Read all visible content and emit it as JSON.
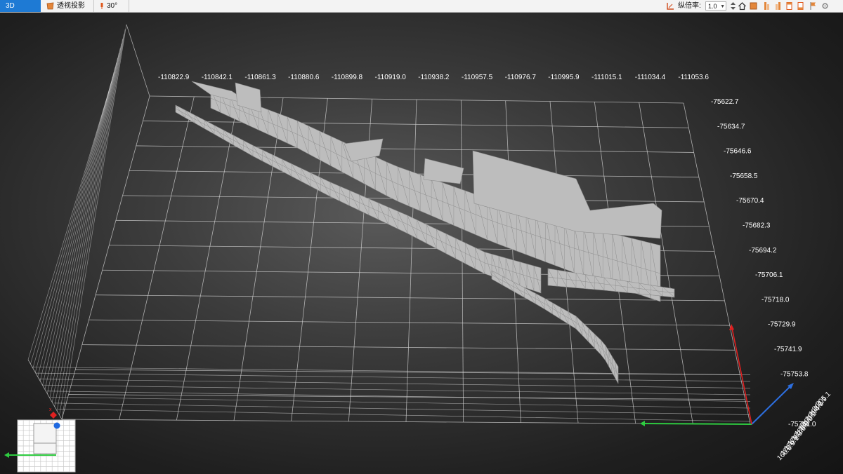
{
  "toolbar": {
    "view_3d": "3D",
    "perspective": "透视投影",
    "angle": "30°",
    "ratio_label": "纵倍率:",
    "ratio_value": "1.0",
    "tools": [
      "home-icon",
      "box-icon",
      "wall-left-icon",
      "wall-right-icon",
      "doc-icon",
      "doc-alt-icon",
      "flag-icon",
      "settings-icon"
    ]
  },
  "grid": {
    "x_labels": [
      "-110822.9",
      "-110842.1",
      "-110861.3",
      "-110880.6",
      "-110899.8",
      "-110919.0",
      "-110938.2",
      "-110957.5",
      "-110976.7",
      "-110995.9",
      "-111015.1",
      "-111034.4",
      "-111053.6"
    ],
    "y_labels": [
      "-75622.7",
      "-75634.7",
      "-75646.6",
      "-75658.5",
      "-75670.4",
      "-75682.3",
      "-75694.2",
      "-75706.1",
      "-75718.0",
      "-75729.9",
      "-75741.9",
      "-75753.8",
      "-75761.0"
    ],
    "z_labels": [
      "205.1",
      "201.9",
      "198.6",
      "195.4",
      "192.2",
      "189.0",
      "185.8",
      "182.5",
      "179.3",
      "176.1",
      "172.9",
      "168.5"
    ]
  },
  "colors": {
    "toolbar_accent": "#1e7ad4",
    "mesh_fill": "#bdbdbd",
    "mesh_edge": "#8c8c8c",
    "grid_line": "#d8d8d8",
    "axis_x": "#2ecc40",
    "axis_y": "#2d6fe0",
    "axis_z": "#e02020"
  }
}
